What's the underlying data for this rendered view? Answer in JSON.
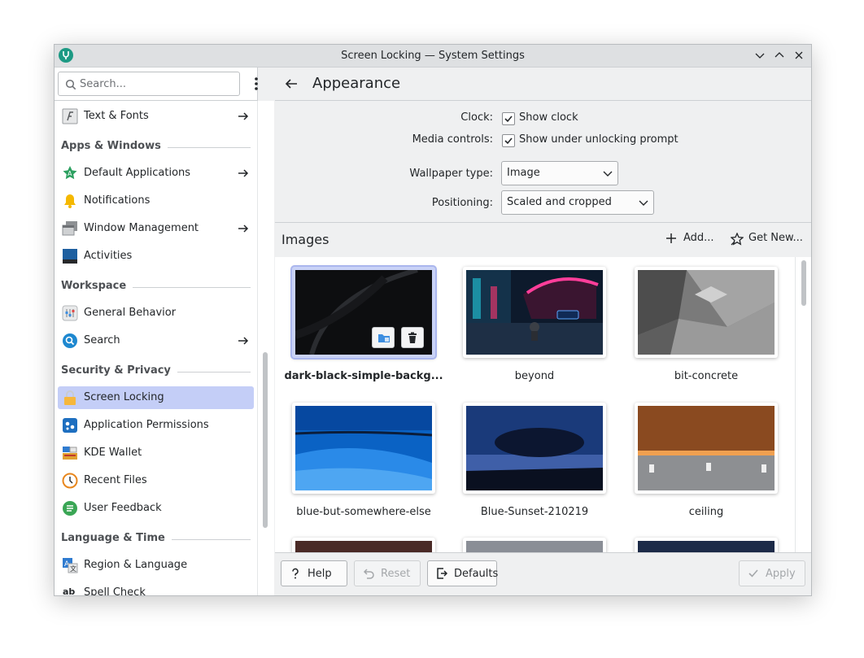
{
  "window": {
    "title": "Screen Locking — System Settings"
  },
  "search": {
    "placeholder": "Search..."
  },
  "sidebar": {
    "items": [
      {
        "label": "Text & Fonts",
        "icon": "text-fonts-icon"
      },
      {
        "section": "Apps & Windows"
      },
      {
        "label": "Default Applications",
        "icon": "default-applications-icon"
      },
      {
        "label": "Notifications",
        "icon": "bell-icon"
      },
      {
        "label": "Window Management",
        "icon": "window-management-icon"
      },
      {
        "label": "Activities",
        "icon": "activities-icon"
      },
      {
        "section": "Workspace"
      },
      {
        "label": "General Behavior",
        "icon": "general-behavior-icon"
      },
      {
        "label": "Search",
        "icon": "search-icon"
      },
      {
        "section": "Security & Privacy"
      },
      {
        "label": "Screen Locking",
        "icon": "screen-locking-icon",
        "selected": true
      },
      {
        "label": "Application Permissions",
        "icon": "application-permissions-icon"
      },
      {
        "label": "KDE Wallet",
        "icon": "kde-wallet-icon"
      },
      {
        "label": "Recent Files",
        "icon": "recent-files-icon"
      },
      {
        "label": "User Feedback",
        "icon": "user-feedback-icon"
      },
      {
        "section": "Language & Time"
      },
      {
        "label": "Region & Language",
        "icon": "region-language-icon"
      },
      {
        "label": "Spell Check",
        "icon": "spell-check-icon"
      }
    ]
  },
  "page": {
    "title": "Appearance"
  },
  "form": {
    "clock_label": "Clock:",
    "clock_option": "Show clock",
    "media_label": "Media controls:",
    "media_option": "Show under unlocking prompt",
    "wallpaper_label": "Wallpaper type:",
    "wallpaper_value": "Image",
    "positioning_label": "Positioning:",
    "positioning_value": "Scaled and cropped"
  },
  "images": {
    "title": "Images",
    "add_label": "Add...",
    "get_new_label": "Get New...",
    "items": [
      {
        "name": "dark-black-simple-backg...",
        "selected": true
      },
      {
        "name": "beyond"
      },
      {
        "name": "bit-concrete"
      },
      {
        "name": "blue-but-somewhere-else"
      },
      {
        "name": "Blue-Sunset-210219"
      },
      {
        "name": "ceiling"
      }
    ]
  },
  "footer": {
    "help_label": "Help",
    "reset_label": "Reset",
    "defaults_label": "Defaults",
    "apply_label": "Apply"
  },
  "colors": {
    "accent": "#c4cef7",
    "selection_frame": "#aab6ee"
  }
}
